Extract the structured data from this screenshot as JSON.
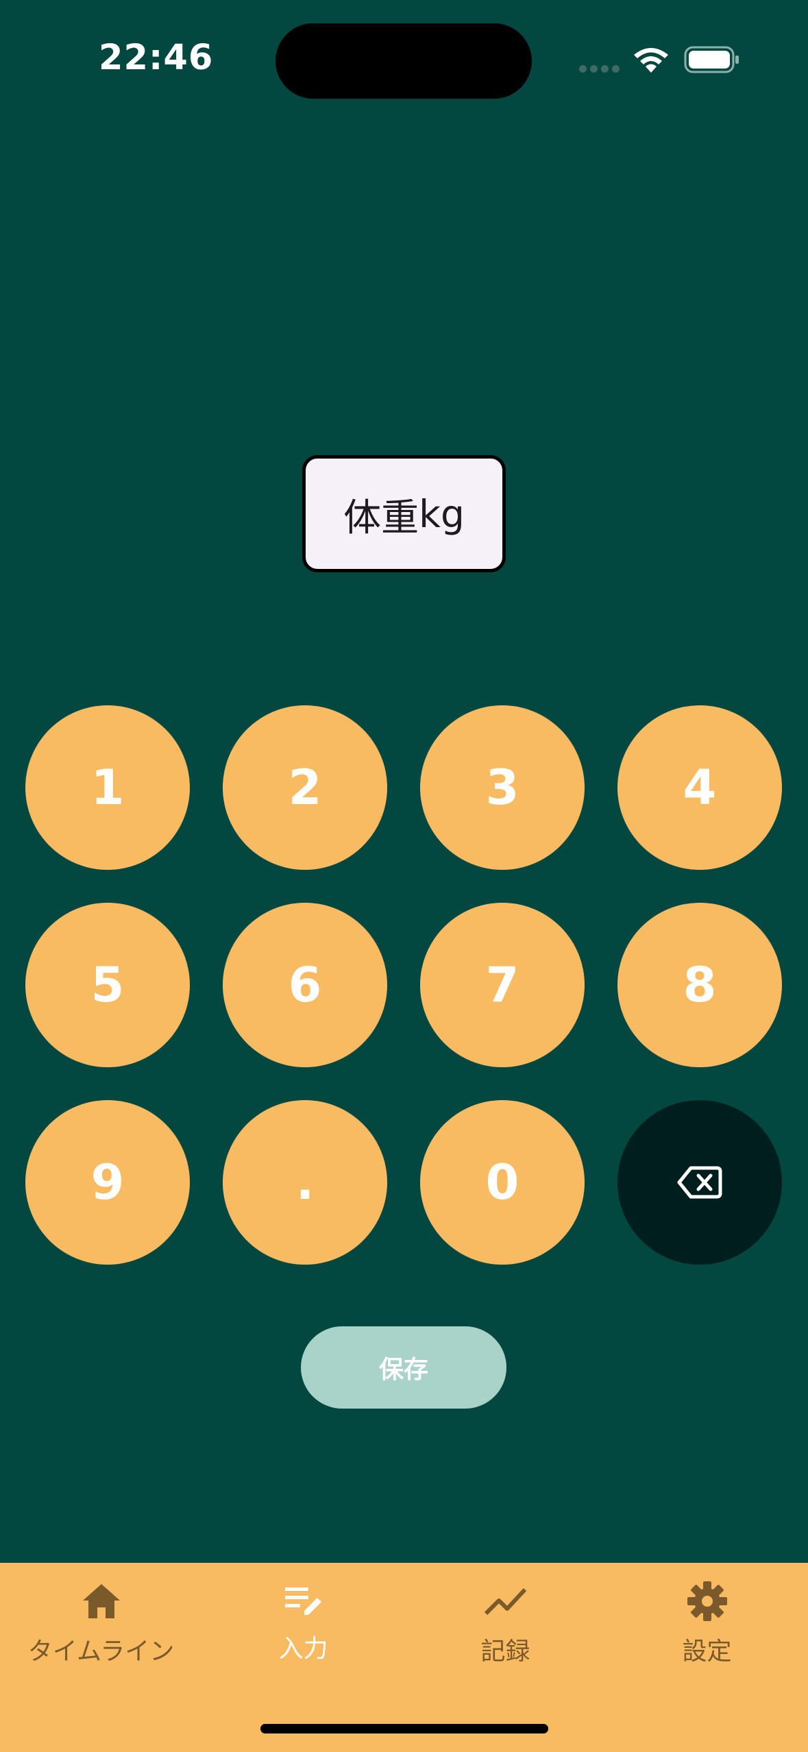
{
  "status_bar": {
    "time": "22:46",
    "wifi_icon": "wifi-icon",
    "battery_icon": "battery-icon"
  },
  "weight_field": {
    "label": "体重",
    "unit": "kg",
    "value": ""
  },
  "keypad": {
    "keys": [
      "1",
      "2",
      "3",
      "4",
      "5",
      "6",
      "7",
      "8",
      "9",
      ".",
      "0"
    ],
    "backspace_icon": "backspace-icon"
  },
  "save_button": {
    "label": "保存"
  },
  "bottom_nav": {
    "items": [
      {
        "label": "タイムライン",
        "icon": "home-icon"
      },
      {
        "label": "入力",
        "icon": "edit-note-icon",
        "active": true
      },
      {
        "label": "記録",
        "icon": "trending-line-icon"
      },
      {
        "label": "設定",
        "icon": "gear-icon"
      }
    ]
  },
  "colors": {
    "background": "#024840",
    "key_fill": "#f8bb62",
    "backspace_fill": "#001e1d",
    "save_fill": "#a9d2c8",
    "nav_bg": "#f8bb62",
    "nav_inactive": "#7a5a2a",
    "nav_active": "#ffffff"
  }
}
